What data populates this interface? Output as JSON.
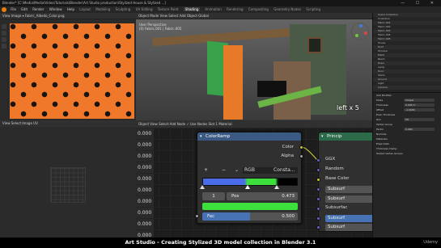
{
  "window": {
    "title": "Blender* [C:\\Media\\Media\\Video\\Tutorials\\Blender\\Art Studio production\\Stylized House & Stylized ...]",
    "controls": [
      "—",
      "☐",
      "✕"
    ]
  },
  "menubar": {
    "items": [
      "File",
      "Edit",
      "Render",
      "Window",
      "Help"
    ],
    "workspaces": [
      "Layout",
      "Modeling",
      "Sculpting",
      "UV Editing",
      "Texture Paint",
      "Shading",
      "Animation",
      "Rendering",
      "Compositing",
      "Geometry Nodes",
      "Scripting"
    ],
    "active_workspace": "Shading"
  },
  "image_editor": {
    "header": "View  Image  ▾  Fabric_Albedo_Color.png"
  },
  "viewport": {
    "header": "Object Mode   View   Select   Add   Object        Global",
    "info_lines": [
      "User Perspective",
      "(0) Fabric.001 | Fabric.005"
    ],
    "overlay_text": "left x 5"
  },
  "outliner": {
    "rows": [
      "Scene Collection",
      "  Collection",
      "    Fabric.001",
      "    Fabric.002",
      "    Fabric.003",
      "    Fabric.004",
      "    Fabric.005",
      "    House",
      "    Roof",
      "    Window",
      "    Plank",
      "    Beam",
      "    Rope",
      "    Lamp",
      "    Door",
      "    Stairs",
      "    Ground",
      "    Light",
      "    Camera"
    ]
  },
  "properties": {
    "rows": [
      {
        "label": "Add Modifier",
        "field": ""
      },
      {
        "label": "Mode",
        "field": "Simple"
      },
      {
        "label": "Thickness",
        "field": "0.005 m"
      },
      {
        "label": "Offset",
        "field": "-1.0000"
      },
      {
        "label": "Even Thickness",
        "field": ""
      },
      {
        "label": "Rim",
        "field": "Fill"
      },
      {
        "label": "Vertex Group",
        "field": ""
      },
      {
        "label": "Factor",
        "field": "0.000"
      },
      {
        "label": "Normals",
        "field": ""
      },
      {
        "label": "Materials",
        "field": ""
      },
      {
        "label": "Edge Data",
        "field": ""
      },
      {
        "label": "Thickness Clamp",
        "field": ""
      },
      {
        "label": "Output Vertex Groups",
        "field": ""
      }
    ]
  },
  "uv_editor": {
    "header": "View   Select   Image   UV"
  },
  "node_editor": {
    "header": "Object   View   Select   Add   Node   ✓ Use Nodes   Slot 1   Material",
    "value_column": [
      "0.000",
      "0.000",
      "0.000",
      "0.000",
      "0.000",
      "0.000",
      "0.000",
      "0.000",
      "0.000",
      "0.000",
      "1.450"
    ],
    "colorramp": {
      "title": "ColorRamp",
      "outputs": [
        "Color",
        "Alpha"
      ],
      "add_label": "+",
      "remove_label": "−",
      "mode": "RGB",
      "interpolation": "Consta...",
      "index": "1",
      "pos_label": "Pos",
      "pos_value": "0.473",
      "fac_label": "Fac",
      "fac_value": "0.500",
      "fac_fraction": 0.5,
      "stops": [
        0.0,
        0.473,
        0.78
      ],
      "colors": [
        "#4a6ce8",
        "#3ddf3d",
        "#000000"
      ]
    },
    "principled": {
      "title": "Princip",
      "items": [
        "GGX",
        "Random",
        "Base Color",
        "Subsurf",
        "Subsurf",
        "Subsurfac",
        "Subsurf",
        "Subsurf"
      ]
    }
  },
  "caption": {
    "text": "Art Studio - Creating Stylized 3D model collection in Blender 3.1",
    "brand": "Udemy"
  }
}
